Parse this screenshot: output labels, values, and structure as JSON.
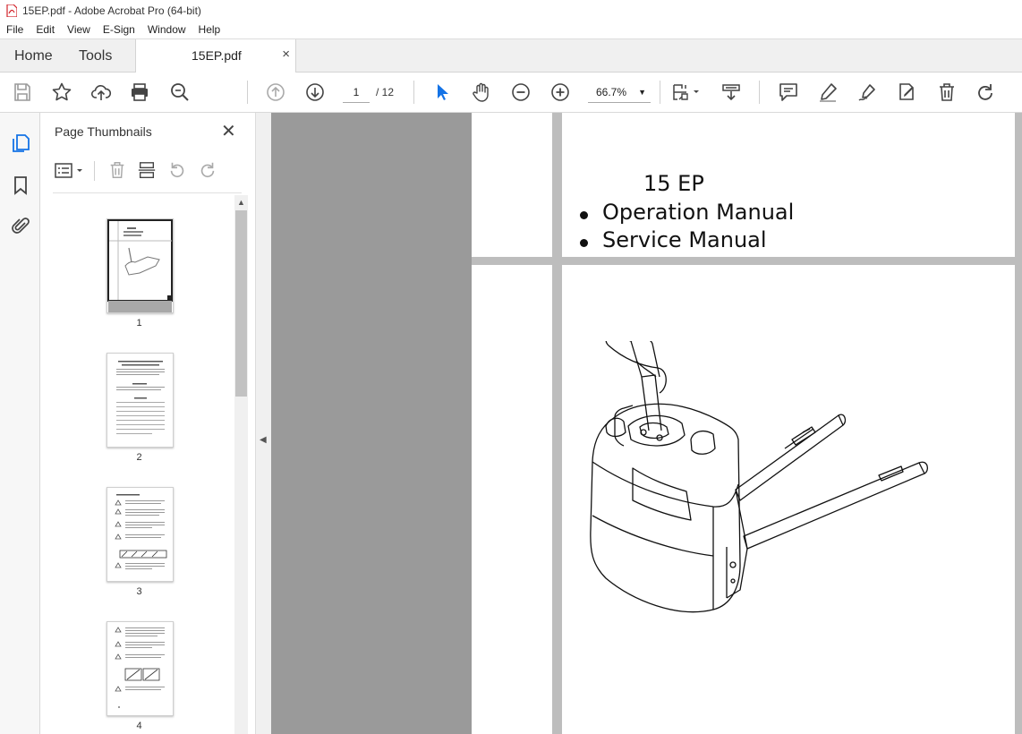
{
  "window": {
    "title": "15EP.pdf - Adobe Acrobat Pro (64-bit)"
  },
  "menu": {
    "items": [
      "File",
      "Edit",
      "View",
      "E-Sign",
      "Window",
      "Help"
    ]
  },
  "tabs": {
    "home": "Home",
    "tools": "Tools",
    "document": "15EP.pdf",
    "close": "×"
  },
  "toolbar": {
    "current_page": "1",
    "total_pages": "/ 12",
    "zoom": "66.7%",
    "icons": [
      "save-icon",
      "bookmark-star-icon",
      "upload-icon",
      "print-icon",
      "search-zoom-icon",
      "page-up-icon",
      "page-down-icon",
      "select-cursor-icon",
      "hand-icon",
      "zoom-out-icon",
      "zoom-in-icon",
      "fit-page-icon",
      "scroll-mode-icon",
      "comment-icon",
      "highlight-icon",
      "sign-icon",
      "fill-sign-icon",
      "delete-icon",
      "rotate-icon"
    ]
  },
  "sidebar": {
    "title": "Page Thumbnails",
    "close": "✕",
    "thumbnails": [
      {
        "label": "1"
      },
      {
        "label": "2"
      },
      {
        "label": "3"
      },
      {
        "label": "4"
      }
    ]
  },
  "document": {
    "model": "15 EP",
    "bullets": [
      "Operation Manual",
      "Service Manual"
    ]
  },
  "colors": {
    "accent": "#1473e6",
    "pdf_red": "#d2232a",
    "doc_background": "#9a9a9a"
  }
}
